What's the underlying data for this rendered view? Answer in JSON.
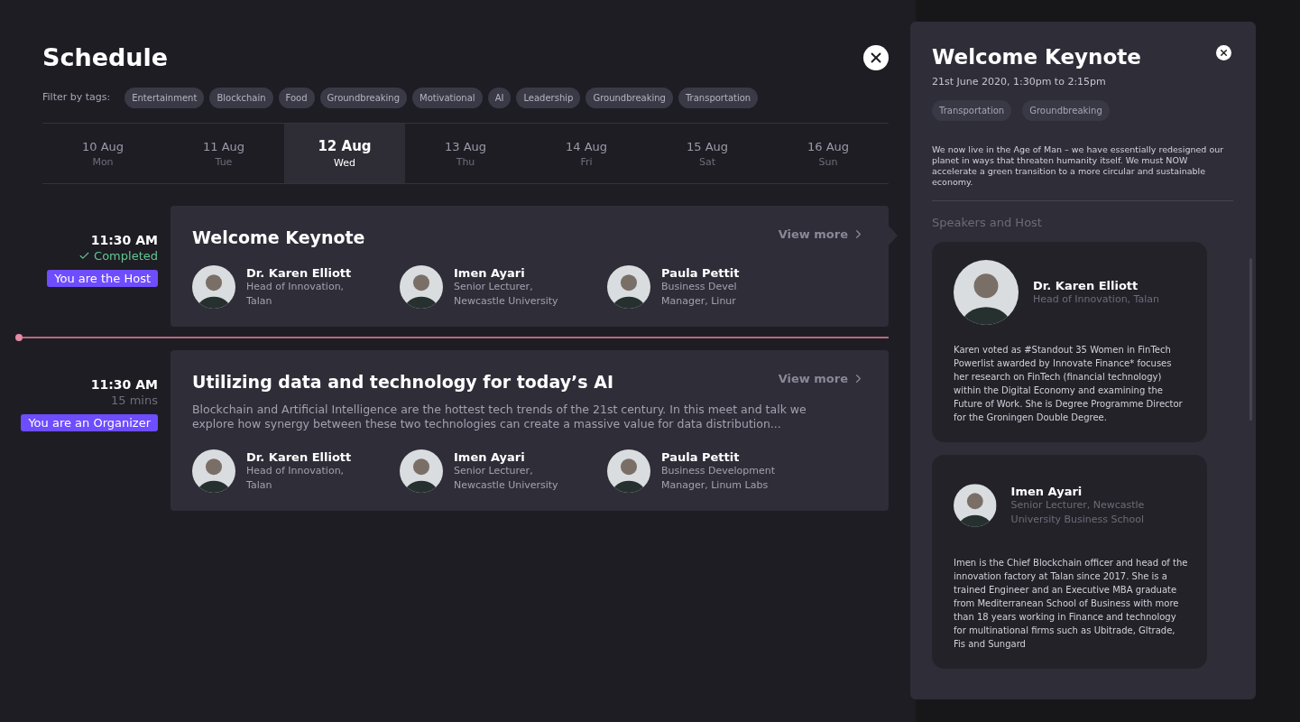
{
  "schedule": {
    "title": "Schedule",
    "filter_label": "Filter by tags:",
    "tags": [
      "Entertainment",
      "Blockchain",
      "Food",
      "Groundbreaking",
      "Motivational",
      "AI",
      "Leadership",
      "Groundbreaking",
      "Transportation"
    ],
    "days": [
      {
        "date": "10 Aug",
        "weekday": "Mon",
        "selected": false
      },
      {
        "date": "11 Aug",
        "weekday": "Tue",
        "selected": false
      },
      {
        "date": "12 Aug",
        "weekday": "Wed",
        "selected": true
      },
      {
        "date": "13 Aug",
        "weekday": "Thu",
        "selected": false
      },
      {
        "date": "14 Aug",
        "weekday": "Fri",
        "selected": false
      },
      {
        "date": "15 Aug",
        "weekday": "Sat",
        "selected": false
      },
      {
        "date": "16 Aug",
        "weekday": "Sun",
        "selected": false
      }
    ],
    "events": [
      {
        "time": "11:30 AM",
        "status": {
          "kind": "completed",
          "text": "Completed"
        },
        "role": "You are the Host",
        "title": "Welcome Keynote",
        "view_more": "View more",
        "selected": true,
        "speakers": [
          {
            "name": "Dr. Karen Elliott",
            "role": "Head of Innovation,",
            "org": "Talan"
          },
          {
            "name": "Imen Ayari",
            "role": "Senior Lecturer,",
            "org": "Newcastle University"
          },
          {
            "name": "Paula Pettit",
            "role": "Business Devel",
            "org": "Manager, Linur"
          }
        ]
      },
      {
        "time": "11:30 AM",
        "status": {
          "kind": "duration",
          "text": "15 mins"
        },
        "role": "You are an Organizer",
        "title": "Utilizing data and technology for today’s AI",
        "description": "Blockchain and Artificial Intelligence are the hottest tech trends of the 21st century. In this meet and talk we explore how  synergy between these two technologies can create a massive value for data distribution...",
        "view_more": "View more",
        "selected": false,
        "speakers": [
          {
            "name": "Dr. Karen Elliott",
            "role": "Head of Innovation,",
            "org": "Talan"
          },
          {
            "name": "Imen Ayari",
            "role": "Senior Lecturer,",
            "org": "Newcastle University"
          },
          {
            "name": "Paula Pettit",
            "role": "Business Development",
            "org": "Manager, Linum Labs"
          }
        ]
      }
    ]
  },
  "detail": {
    "title": "Welcome Keynote",
    "datetime": "21st June 2020, 1:30pm to 2:15pm",
    "tags": [
      "Transportation",
      "Groundbreaking"
    ],
    "description": "We now live in the Age of Man – we have essentially redesigned our planet in ways that threaten humanity itself. We must NOW accelerate a green transition to a more circular and sustainable economy.",
    "speakers_heading": "Speakers and Host",
    "speakers": [
      {
        "name": "Dr. Karen Elliott",
        "role": "Head of Innovation, Talan",
        "bio": "Karen voted as #Standout 35 Women in FinTech Powerlist awarded by Innovate Finance* focuses her research on FinTech (financial technology) within the Digital Economy and examining the Future of Work. She is Degree Programme Director for the Groningen Double Degree."
      },
      {
        "name": "Imen Ayari",
        "role": "Senior Lecturer, Newcastle University Business School",
        "bio": "Imen is the Chief Blockchain officer and head of the innovation factory at Talan since 2017. She is a trained Engineer and an Executive MBA graduate from Mediterranean School of Business with more than 18 years working in Finance and technology for multinational firms such as Ubitrade, Gltrade, Fis and Sungard"
      }
    ]
  }
}
